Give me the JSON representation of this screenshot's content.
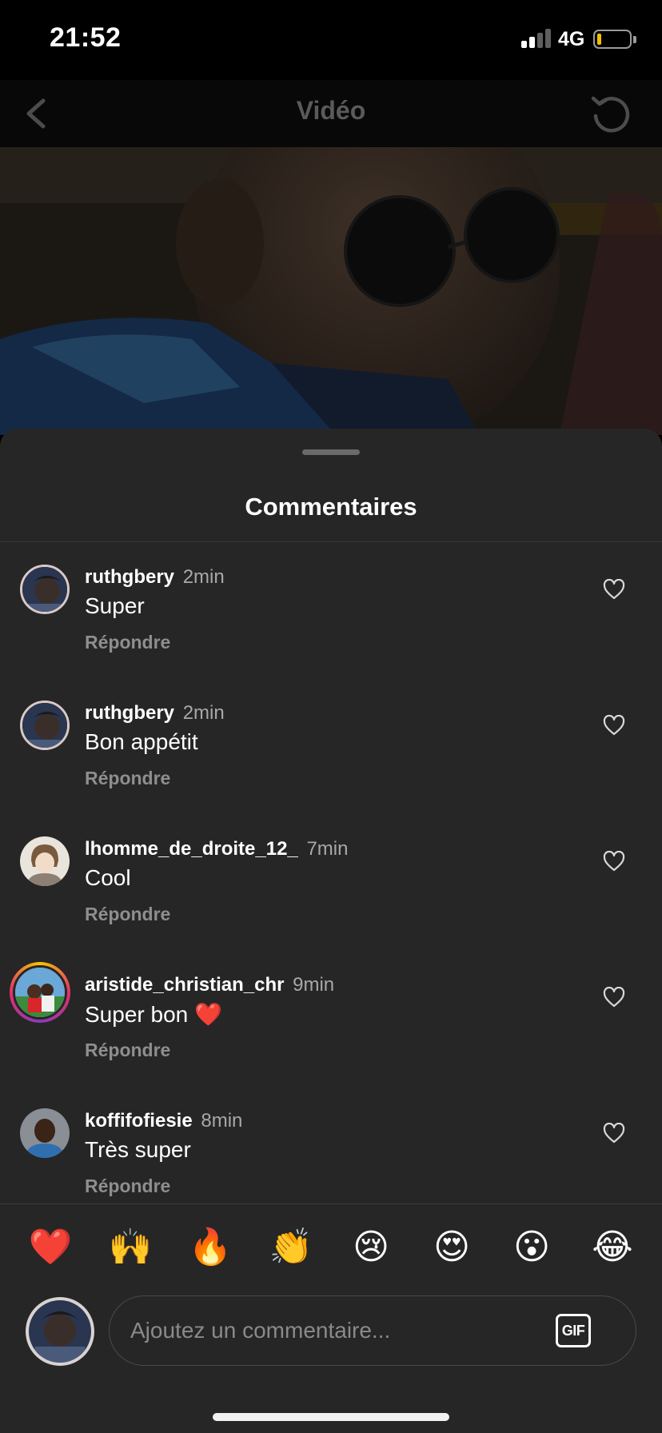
{
  "status_bar": {
    "time": "21:52",
    "network": "4G",
    "battery_level": 0.12,
    "battery_color": "#f2c200"
  },
  "nav": {
    "title": "Vidéo",
    "back_icon": "chevron-left-icon",
    "refresh_icon": "refresh-icon"
  },
  "sheet": {
    "title": "Commentaires"
  },
  "comments": [
    {
      "username": "ruthgbery",
      "time": "2min",
      "text": "Super",
      "reply_label": "Répondre",
      "avatar": "ruthgbery"
    },
    {
      "username": "ruthgbery",
      "time": "2min",
      "text": "Bon appétit",
      "reply_label": "Répondre",
      "avatar": "ruthgbery"
    },
    {
      "username": "lhomme_de_droite_12_",
      "time": "7min",
      "text": "Cool",
      "reply_label": "Répondre",
      "avatar": "anime"
    },
    {
      "username": "aristide_christian_chr",
      "time": "9min",
      "text": "Super bon ❤️",
      "reply_label": "Répondre",
      "avatar": "story"
    },
    {
      "username": "koffifofiesie",
      "time": "8min",
      "text": "Très super",
      "reply_label": "Répondre",
      "avatar": "koffi"
    }
  ],
  "emoji_bar": [
    "❤️",
    "🙌",
    "🔥",
    "👏",
    "😢",
    "😍",
    "😮",
    "😂"
  ],
  "composer": {
    "placeholder": "Ajoutez un commentaire...",
    "gif_label": "GIF"
  },
  "colors": {
    "sheet_bg": "#262626",
    "secondary_text": "#a8a8a8",
    "reply_text": "#8e8e8e"
  }
}
